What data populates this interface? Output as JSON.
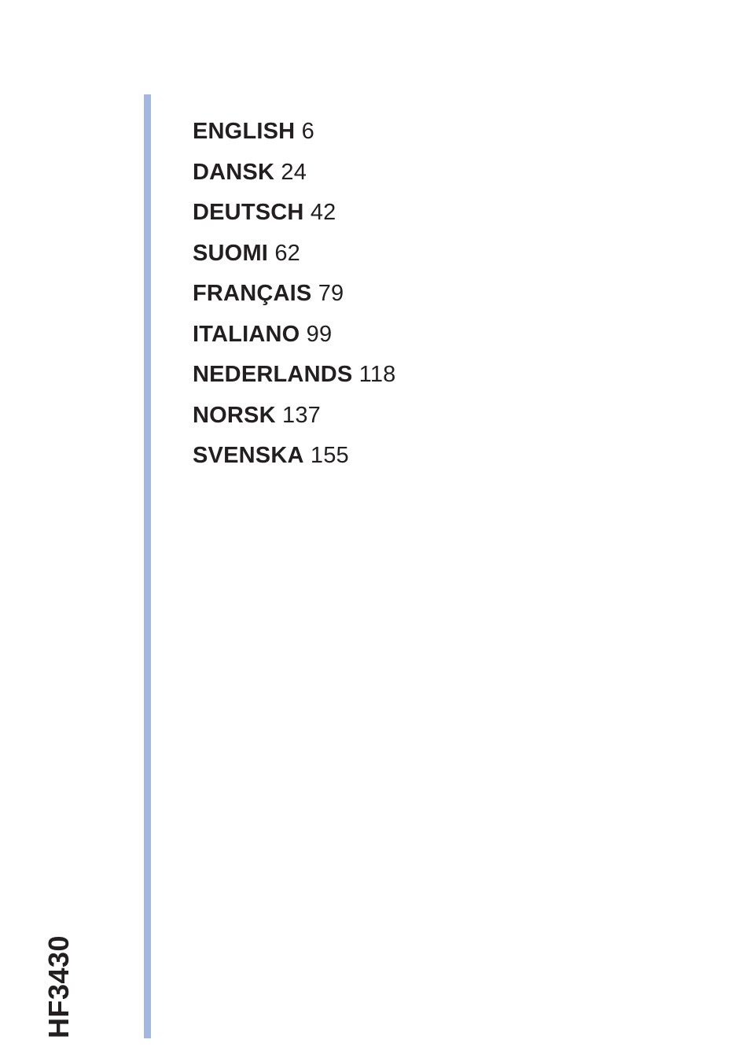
{
  "model": "HF3430",
  "toc": [
    {
      "language": "ENGLISH",
      "page": "6"
    },
    {
      "language": "DANSK",
      "page": "24"
    },
    {
      "language": "DEUTSCH",
      "page": "42"
    },
    {
      "language": "SUOMI",
      "page": "62"
    },
    {
      "language": "FRANÇAIS",
      "page": "79"
    },
    {
      "language": "ITALIANO",
      "page": "99"
    },
    {
      "language": "NEDERLANDS",
      "page": "118"
    },
    {
      "language": "NORSK",
      "page": "137"
    },
    {
      "language": "SVENSKA",
      "page": "155"
    }
  ]
}
